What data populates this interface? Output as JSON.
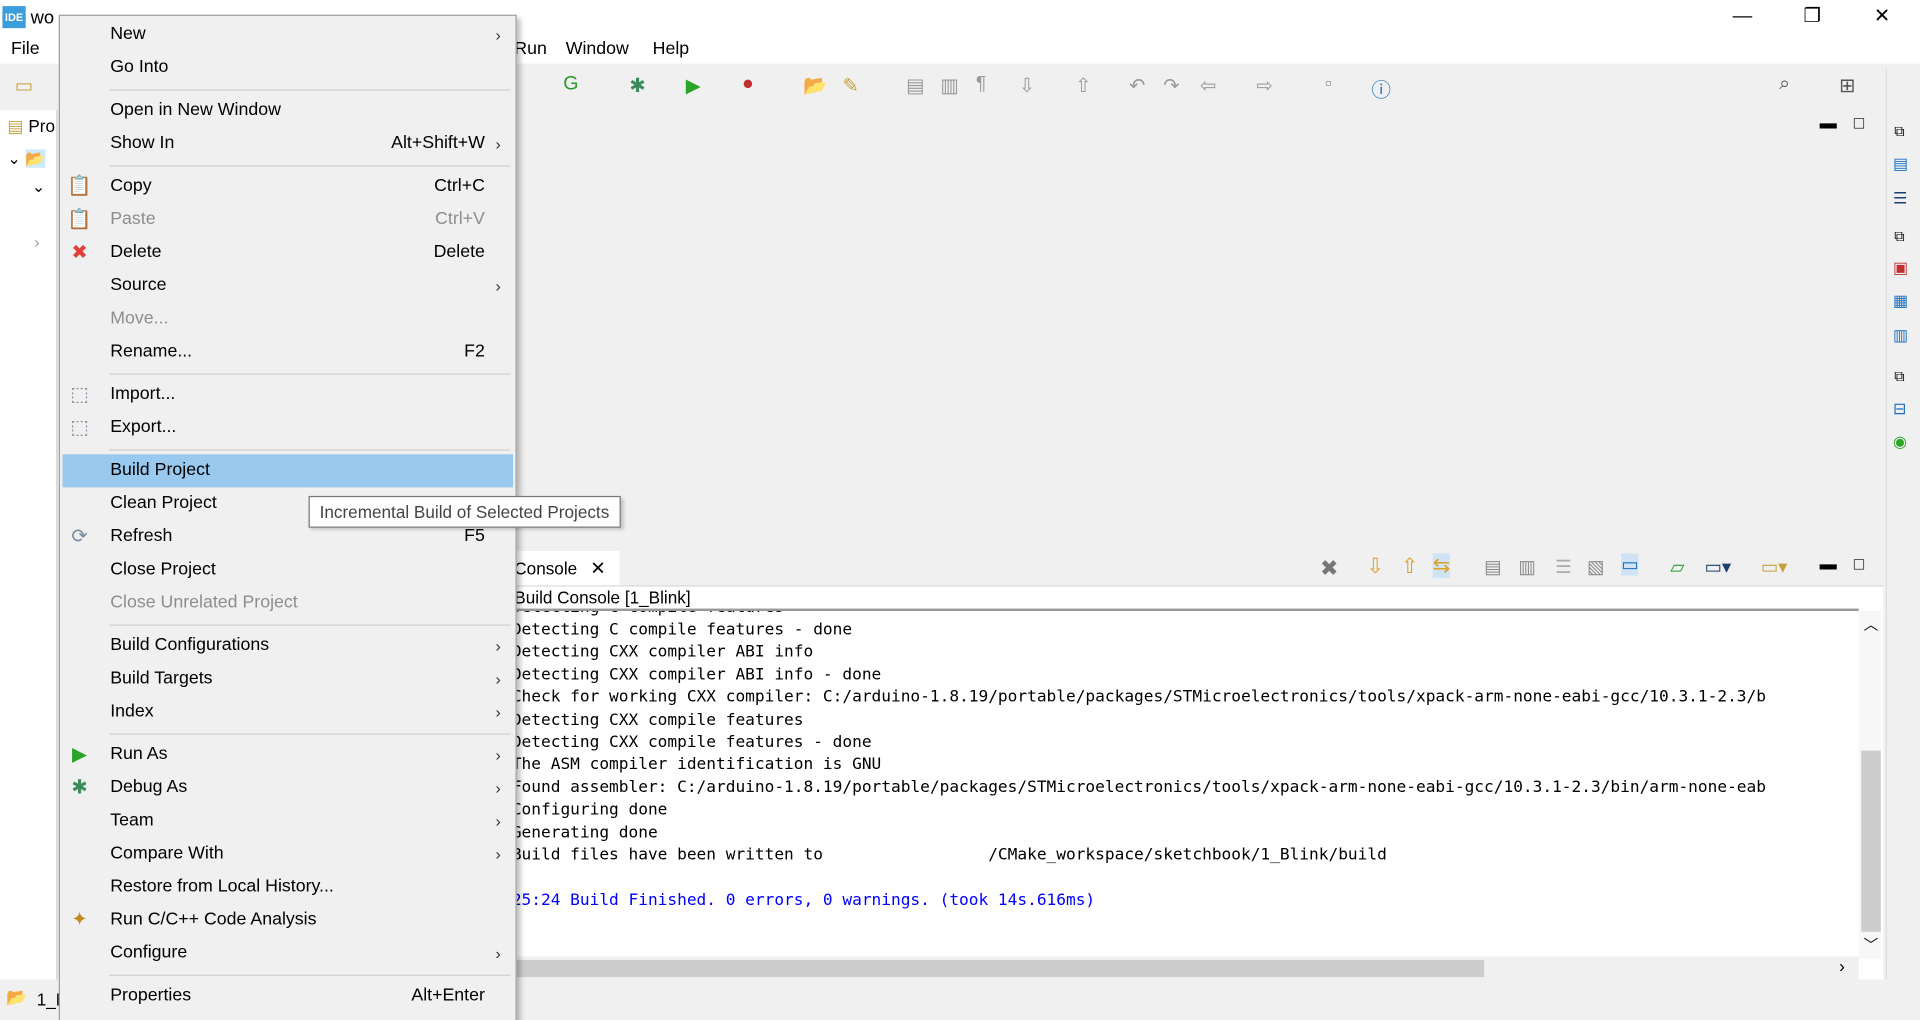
{
  "window": {
    "title_visible": "wo",
    "app_icon": "IDE",
    "minimize": "—",
    "restore": "❐",
    "close": "✕"
  },
  "menubar": {
    "items": [
      "File",
      "Run",
      "Window",
      "Help"
    ]
  },
  "left_panel": {
    "tab_label": "Pro",
    "status_label": "1_E"
  },
  "console": {
    "tab_label": "Console",
    "title": "Build Console [1_Blink]",
    "partial_top_line": "Detecting C compile features",
    "lines": [
      "Detecting C compile features - done",
      "Detecting CXX compiler ABI info",
      "Detecting CXX compiler ABI info - done",
      "Check for working CXX compiler: C:/arduino-1.8.19/portable/packages/STMicroelectronics/tools/xpack-arm-none-eabi-gcc/10.3.1-2.3/b",
      "Detecting CXX compile features",
      "Detecting CXX compile features - done",
      "The ASM compiler identification is GNU",
      "Found assembler: C:/arduino-1.8.19/portable/packages/STMicroelectronics/tools/xpack-arm-none-eabi-gcc/10.3.1-2.3/bin/arm-none-eab",
      "Configuring done",
      "Generating done",
      "Build files have been written to                 /CMake_workspace/sketchbook/1_Blink/build",
      "",
      "25:24 Build Finished. 0 errors, 0 warnings. (took 14s.616ms)"
    ],
    "finish_color": "#0000ff"
  },
  "context_menu": {
    "items": [
      {
        "label": "New",
        "submenu": true
      },
      {
        "label": "Go Into"
      },
      {
        "sep": true
      },
      {
        "label": "Open in New Window"
      },
      {
        "label": "Show In",
        "shortcut": "Alt+Shift+W",
        "submenu": true
      },
      {
        "sep": true
      },
      {
        "label": "Copy",
        "shortcut": "Ctrl+C",
        "icon": "copy-icon",
        "glyph": "📋"
      },
      {
        "label": "Paste",
        "shortcut": "Ctrl+V",
        "icon": "paste-icon",
        "glyph": "📋",
        "disabled": true
      },
      {
        "label": "Delete",
        "shortcut": "Delete",
        "icon": "delete-icon",
        "glyph": "✖",
        "icon_color": "#e0403a"
      },
      {
        "label": "Source",
        "submenu": true
      },
      {
        "label": "Move...",
        "disabled": true
      },
      {
        "label": "Rename...",
        "shortcut": "F2"
      },
      {
        "sep": true
      },
      {
        "label": "Import...",
        "icon": "import-icon",
        "glyph": "⬚"
      },
      {
        "label": "Export...",
        "icon": "export-icon",
        "glyph": "⬚"
      },
      {
        "sep": true
      },
      {
        "label": "Build Project",
        "highlighted": true
      },
      {
        "label": "Clean Project"
      },
      {
        "label": "Refresh",
        "shortcut": "F5",
        "icon": "refresh-icon",
        "glyph": "⟳"
      },
      {
        "label": "Close Project"
      },
      {
        "label": "Close Unrelated Project",
        "disabled": true
      },
      {
        "sep": true
      },
      {
        "label": "Build Configurations",
        "submenu": true
      },
      {
        "label": "Build Targets",
        "submenu": true
      },
      {
        "label": "Index",
        "submenu": true
      },
      {
        "sep": true
      },
      {
        "label": "Run As",
        "submenu": true,
        "icon": "run-icon",
        "glyph": "▶",
        "icon_color": "#2aa52a"
      },
      {
        "label": "Debug As",
        "submenu": true,
        "icon": "debug-bug-icon",
        "glyph": "✱",
        "icon_color": "#3a8a5a"
      },
      {
        "label": "Team",
        "submenu": true
      },
      {
        "label": "Compare With",
        "submenu": true
      },
      {
        "label": "Restore from Local History..."
      },
      {
        "label": "Run C/C++ Code Analysis",
        "icon": "code-analysis-icon",
        "glyph": "✦",
        "icon_color": "#c08a20"
      },
      {
        "label": "Configure",
        "submenu": true
      },
      {
        "sep": true
      },
      {
        "label": "Properties",
        "shortcut": "Alt+Enter"
      }
    ]
  },
  "tooltip": {
    "text": "Incremental Build of Selected Projects"
  },
  "colors": {
    "highlight": "#99c9ef",
    "ide_icon": "#3c9ddd"
  }
}
